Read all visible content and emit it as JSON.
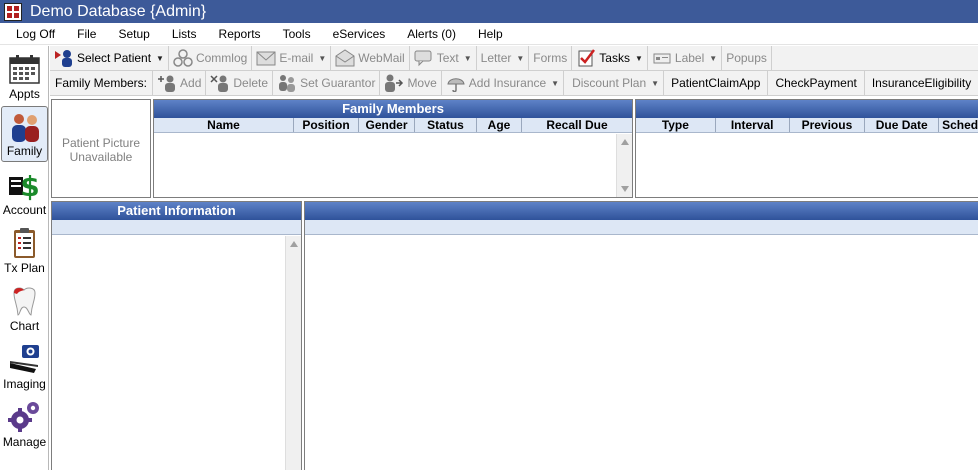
{
  "window": {
    "title": "Demo Database {Admin}"
  },
  "menu": [
    "Log Off",
    "File",
    "Setup",
    "Lists",
    "Reports",
    "Tools",
    "eServices",
    "Alerts (0)",
    "Help"
  ],
  "modules": [
    {
      "label": "Appts",
      "icon": "calendar-icon"
    },
    {
      "label": "Family",
      "icon": "family-icon",
      "active": true
    },
    {
      "label": "Account",
      "icon": "dollar-icon"
    },
    {
      "label": "Tx Plan",
      "icon": "clipboard-icon"
    },
    {
      "label": "Chart",
      "icon": "tooth-icon"
    },
    {
      "label": "Imaging",
      "icon": "camera-scanner-icon"
    },
    {
      "label": "Manage",
      "icon": "gears-icon"
    }
  ],
  "toolbar_main": {
    "select_patient": "Select Patient",
    "commlog": "Commlog",
    "email": "E-mail",
    "webmail": "WebMail",
    "text": "Text",
    "letter": "Letter",
    "forms": "Forms",
    "tasks": "Tasks",
    "label": "Label",
    "popups": "Popups"
  },
  "toolbar_family": {
    "family_members_label": "Family Members:",
    "add": "Add",
    "delete": "Delete",
    "set_guarantor": "Set Guarantor",
    "move": "Move",
    "add_insurance": "Add Insurance",
    "discount_plan": "Discount Plan",
    "patient_claim_app": "PatientClaimApp",
    "check_payment": "CheckPayment",
    "insurance_eligibility": "InsuranceEligibility"
  },
  "patient_picture": {
    "text": "Patient Picture Unavailable"
  },
  "family_grid": {
    "title": "Family Members",
    "columns": [
      "Name",
      "Position",
      "Gender",
      "Status",
      "Age",
      "Recall Due"
    ]
  },
  "recall_grid": {
    "columns": [
      "Type",
      "Interval",
      "Previous",
      "Due Date",
      "Sched"
    ]
  },
  "patient_info": {
    "title": "Patient Information"
  }
}
